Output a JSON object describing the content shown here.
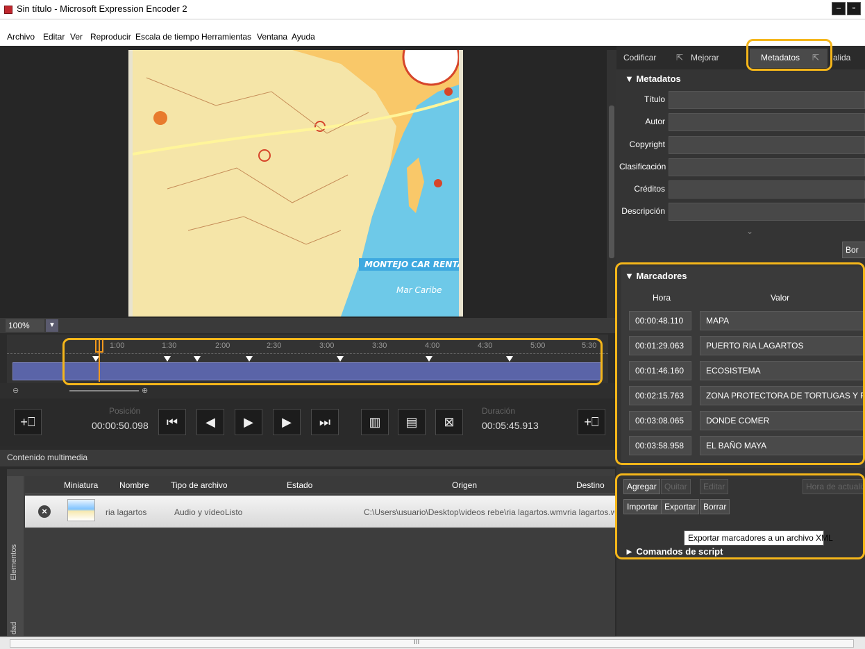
{
  "window": {
    "title": "Sin título - Microsoft Expression Encoder 2",
    "min": "–",
    "restore": "▫"
  },
  "menu": [
    "Archivo",
    "Editar",
    "Ver",
    "Reproducir",
    "Escala de tiempo",
    "Herramientas",
    "Ventana",
    "Ayuda"
  ],
  "video": {
    "map_labels": [
      "MONTEJO CAR RENTAL",
      "Mar Caribe"
    ]
  },
  "zoom": {
    "value": "100%"
  },
  "timeline": {
    "ticks": [
      "1:00",
      "1:30",
      "2:00",
      "2:30",
      "3:00",
      "3:30",
      "4:00",
      "4:30",
      "5:00",
      "5:30"
    ]
  },
  "transport": {
    "position_label": "Posición",
    "position_value": "00:00:50.098",
    "duration_label": "Duración",
    "duration_value": "00:05:45.913"
  },
  "media": {
    "header": "Contenido multimedia",
    "side_tab": "Elementos",
    "side_tab2": "dad",
    "columns": [
      "Miniatura",
      "Nombre",
      "Tipo de archivo",
      "Estado",
      "Origen",
      "Destino"
    ],
    "row": {
      "nombre": "ria lagartos",
      "tipo": "Audio y vídeo",
      "estado": "Listo",
      "origen": "C:\\Users\\usuario\\Desktop\\videos rebe\\ria lagartos.wmv",
      "destino": "ria lagartos.w"
    }
  },
  "tabs": {
    "codificar": "Codificar",
    "mejorar": "Mejorar",
    "metadatos": "Metadatos",
    "salida": "alida"
  },
  "metadata": {
    "title": "▼ Metadatos",
    "fields": [
      "Título",
      "Autor",
      "Copyright",
      "Clasificación",
      "Créditos",
      "Descripción"
    ],
    "button": "Bor"
  },
  "markers": {
    "title": "▼ Marcadores",
    "col_hora": "Hora",
    "col_valor": "Valor",
    "rows": [
      {
        "hora": "00:00:48.110",
        "valor": "MAPA"
      },
      {
        "hora": "00:01:29.063",
        "valor": "PUERTO RIA LAGARTOS"
      },
      {
        "hora": "00:01:46.160",
        "valor": "ECOSISTEMA"
      },
      {
        "hora": "00:02:15.763",
        "valor": "ZONA PROTECTORA DE TORTUGAS Y FLAMIN"
      },
      {
        "hora": "00:03:08.065",
        "valor": "DONDE COMER"
      },
      {
        "hora": "00:03:58.958",
        "valor": "EL BAÑO MAYA"
      }
    ]
  },
  "marker_buttons": {
    "agregar": "Agregar",
    "quitar": "Quitar",
    "editar": "Editar",
    "hora_actualizar": "Hora de actualiz",
    "importar": "Importar",
    "exportar": "Exportar",
    "borrar": "Borrar"
  },
  "tooltip": "Exportar marcadores a un archivo XML",
  "script": {
    "title": "► Comandos de script"
  },
  "scroll": {
    "grip": "III"
  }
}
